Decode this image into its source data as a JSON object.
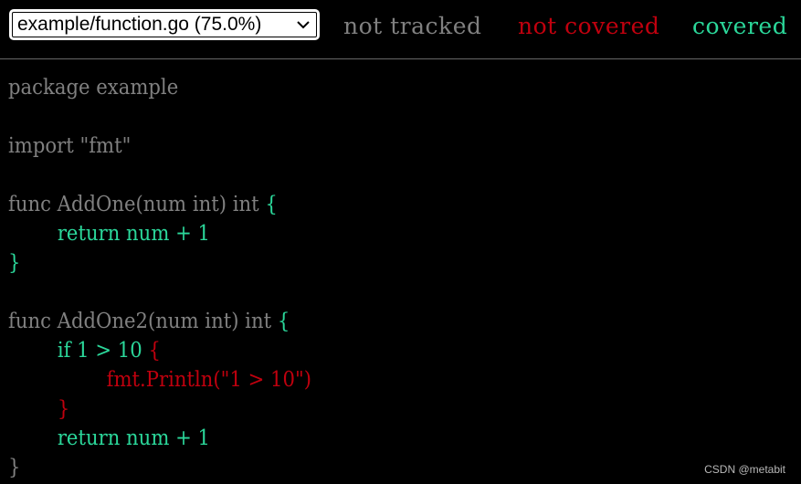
{
  "topbar": {
    "file_select": {
      "selected": "example/function.go (75.0%)",
      "icon": "chevron-down-icon"
    },
    "legend": {
      "not_tracked": "not tracked",
      "not_covered": "not covered",
      "covered": "covered"
    }
  },
  "colors": {
    "background": "#000000",
    "not_tracked": "#808080",
    "not_covered": "#c0000e",
    "covered": "#2bd79a"
  },
  "source": {
    "lines": [
      [
        {
          "text": "package example",
          "cls": "nt"
        }
      ],
      [
        {
          "text": "",
          "cls": "nt"
        }
      ],
      [
        {
          "text": "import \"fmt\"",
          "cls": "nt"
        }
      ],
      [
        {
          "text": "",
          "cls": "nt"
        }
      ],
      [
        {
          "text": "func AddOne(num int) int ",
          "cls": "nt"
        },
        {
          "text": "{",
          "cls": "cov1"
        }
      ],
      [
        {
          "text": "\t",
          "cls": "nt"
        },
        {
          "text": "return num + 1",
          "cls": "cov1"
        }
      ],
      [
        {
          "text": "}",
          "cls": "cov1"
        }
      ],
      [
        {
          "text": "",
          "cls": "nt"
        }
      ],
      [
        {
          "text": "func AddOne2(num int) int ",
          "cls": "nt"
        },
        {
          "text": "{",
          "cls": "cov1"
        }
      ],
      [
        {
          "text": "\t",
          "cls": "nt"
        },
        {
          "text": "if 1 > 10 ",
          "cls": "cov1"
        },
        {
          "text": "{",
          "cls": "cov0"
        }
      ],
      [
        {
          "text": "\t\t",
          "cls": "nt"
        },
        {
          "text": "fmt.Println(\"1 > 10\")",
          "cls": "cov0"
        }
      ],
      [
        {
          "text": "\t",
          "cls": "nt"
        },
        {
          "text": "}",
          "cls": "cov0"
        }
      ],
      [
        {
          "text": "\t",
          "cls": "nt"
        },
        {
          "text": "return num + 1",
          "cls": "cov1"
        }
      ],
      [
        {
          "text": "}",
          "cls": "nt"
        }
      ]
    ]
  },
  "watermark": "CSDN @metabit"
}
